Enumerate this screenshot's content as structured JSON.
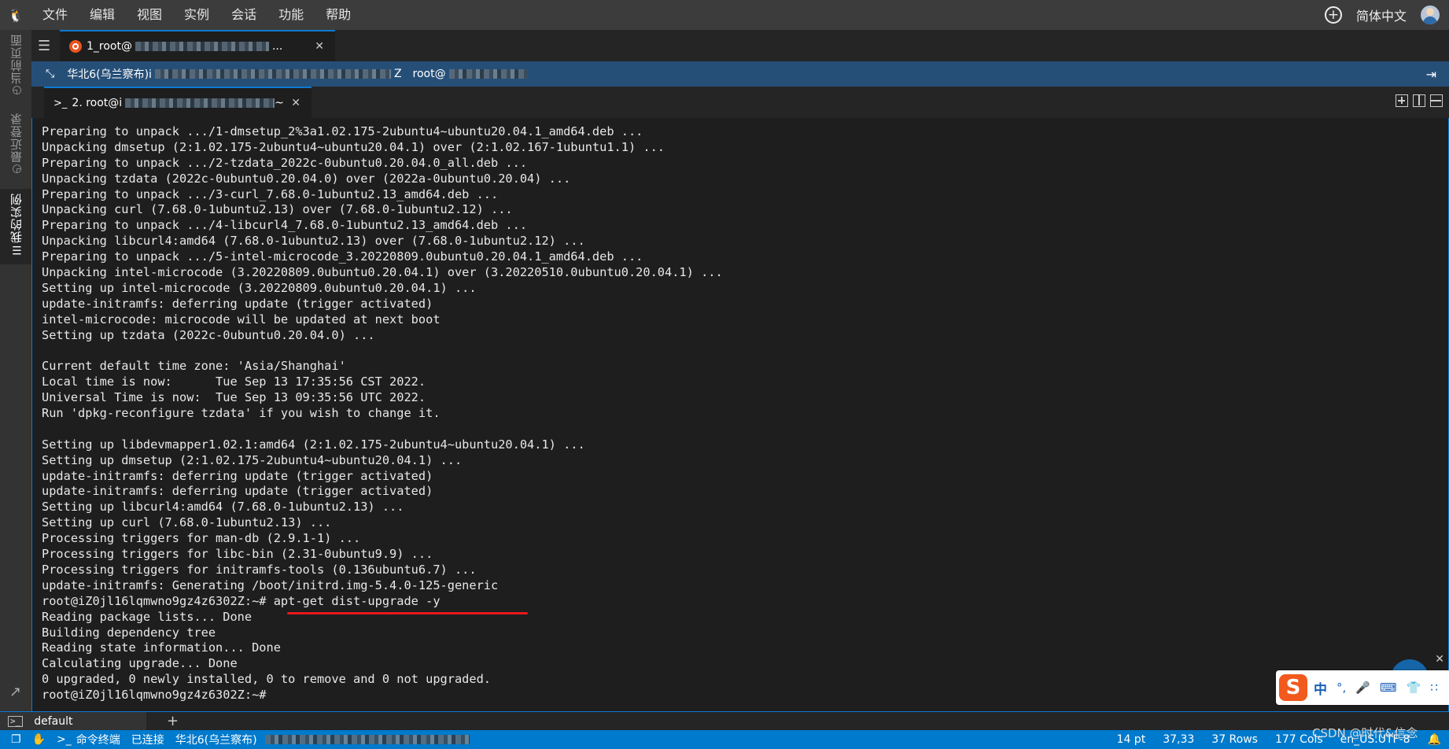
{
  "menubar": {
    "logo_icon": "linux-tux-icon",
    "items": [
      "文件",
      "编辑",
      "视图",
      "实例",
      "会话",
      "功能",
      "帮助"
    ],
    "language": "简体中文"
  },
  "activity_bar": {
    "tabs": [
      {
        "label": "当前页面",
        "icon": "clock-icon"
      },
      {
        "label": "最近登录",
        "icon": "history-icon"
      },
      {
        "label": "我的实例",
        "icon": "list-icon"
      }
    ]
  },
  "tabs": {
    "session_tab_title": "1_root@",
    "session_tab_suffix": "..."
  },
  "connection_bar": {
    "region": "华北6(乌兰察布)i",
    "suffix": "Z",
    "user": "root@"
  },
  "terminal_tab": {
    "prefix": ">_",
    "title": "2. root@i",
    "suffix": "~"
  },
  "terminal": {
    "lines": [
      "Preparing to unpack .../1-dmsetup_2%3a1.02.175-2ubuntu4~ubuntu20.04.1_amd64.deb ...",
      "Unpacking dmsetup (2:1.02.175-2ubuntu4~ubuntu20.04.1) over (2:1.02.167-1ubuntu1.1) ...",
      "Preparing to unpack .../2-tzdata_2022c-0ubuntu0.20.04.0_all.deb ...",
      "Unpacking tzdata (2022c-0ubuntu0.20.04.0) over (2022a-0ubuntu0.20.04) ...",
      "Preparing to unpack .../3-curl_7.68.0-1ubuntu2.13_amd64.deb ...",
      "Unpacking curl (7.68.0-1ubuntu2.13) over (7.68.0-1ubuntu2.12) ...",
      "Preparing to unpack .../4-libcurl4_7.68.0-1ubuntu2.13_amd64.deb ...",
      "Unpacking libcurl4:amd64 (7.68.0-1ubuntu2.13) over (7.68.0-1ubuntu2.12) ...",
      "Preparing to unpack .../5-intel-microcode_3.20220809.0ubuntu0.20.04.1_amd64.deb ...",
      "Unpacking intel-microcode (3.20220809.0ubuntu0.20.04.1) over (3.20220510.0ubuntu0.20.04.1) ...",
      "Setting up intel-microcode (3.20220809.0ubuntu0.20.04.1) ...",
      "update-initramfs: deferring update (trigger activated)",
      "intel-microcode: microcode will be updated at next boot",
      "Setting up tzdata (2022c-0ubuntu0.20.04.0) ...",
      "",
      "Current default time zone: 'Asia/Shanghai'",
      "Local time is now:      Tue Sep 13 17:35:56 CST 2022.",
      "Universal Time is now:  Tue Sep 13 09:35:56 UTC 2022.",
      "Run 'dpkg-reconfigure tzdata' if you wish to change it.",
      "",
      "Setting up libdevmapper1.02.1:amd64 (2:1.02.175-2ubuntu4~ubuntu20.04.1) ...",
      "Setting up dmsetup (2:1.02.175-2ubuntu4~ubuntu20.04.1) ...",
      "update-initramfs: deferring update (trigger activated)",
      "update-initramfs: deferring update (trigger activated)",
      "Setting up libcurl4:amd64 (7.68.0-1ubuntu2.13) ...",
      "Setting up curl (7.68.0-1ubuntu2.13) ...",
      "Processing triggers for man-db (2.9.1-1) ...",
      "Processing triggers for libc-bin (2.31-0ubuntu9.9) ...",
      "Processing triggers for initramfs-tools (0.136ubuntu6.7) ...",
      "update-initramfs: Generating /boot/initrd.img-5.4.0-125-generic",
      "root@iZ0jl16lqmwno9gz4z6302Z:~# apt-get dist-upgrade -y",
      "Reading package lists... Done",
      "Building dependency tree",
      "Reading state information... Done",
      "Calculating upgrade... Done",
      "0 upgraded, 0 newly installed, 0 to remove and 0 not upgraded.",
      "root@iZ0jl16lqmwno9gz4z6302Z:~#"
    ],
    "highlight_color": "#e8171d"
  },
  "panel": {
    "tab_label": "default",
    "add_label": "+"
  },
  "statusbar": {
    "command_terminal": "命令终端",
    "connected": "已连接",
    "region": "华北6(乌兰察布)",
    "font_size": "14 pt",
    "cursor": "37,33",
    "rows": "37 Rows",
    "cols": "177 Cols",
    "encoding": "en_US.UTF-8"
  },
  "ime": {
    "logo": "S",
    "mode": "中",
    "punct": "°,"
  },
  "watermark": "CSDN @时代&信念",
  "colors": {
    "accent": "#007acc",
    "connection_bar": "#264f78",
    "terminal_bg": "#1e1e1e"
  }
}
